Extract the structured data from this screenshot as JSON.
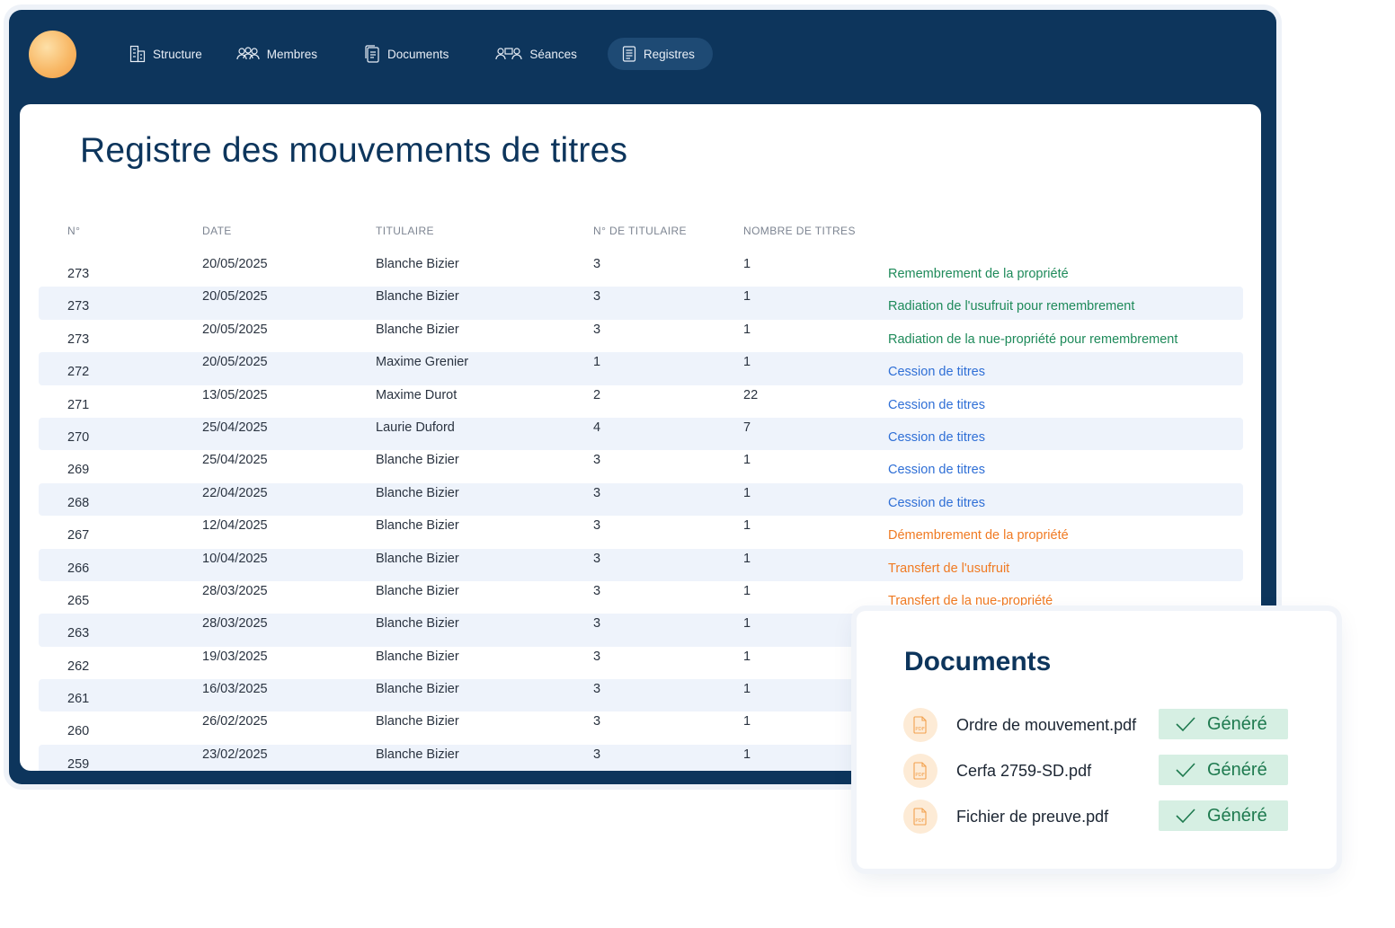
{
  "nav": {
    "items": [
      {
        "label": "Structure",
        "icon": "building-icon"
      },
      {
        "label": "Membres",
        "icon": "members-icon"
      },
      {
        "label": "Documents",
        "icon": "documents-icon"
      },
      {
        "label": "Séances",
        "icon": "meetings-icon"
      },
      {
        "label": "Registres",
        "icon": "register-icon",
        "active": true
      }
    ]
  },
  "page": {
    "title": "Registre des mouvements de titres"
  },
  "table": {
    "headers": [
      "N°",
      "DATE",
      "TITULAIRE",
      "N° DE TITULAIRE",
      "NOMBRE DE TITRES"
    ],
    "rows": [
      {
        "num": "273",
        "date": "20/05/2025",
        "holder": "Blanche Bizier",
        "holder_num": "3",
        "count": "1",
        "operation": "Remembrement de la propriété",
        "color": "#1e8a5a"
      },
      {
        "num": "273",
        "date": "20/05/2025",
        "holder": "Blanche Bizier",
        "holder_num": "3",
        "count": "1",
        "operation": "Radiation de l'usufruit pour remembrement",
        "color": "#1e8a5a"
      },
      {
        "num": "273",
        "date": "20/05/2025",
        "holder": "Blanche Bizier",
        "holder_num": "3",
        "count": "1",
        "operation": "Radiation de la nue-propriété pour remembrement",
        "color": "#1e8a5a"
      },
      {
        "num": "272",
        "date": "20/05/2025",
        "holder": "Maxime Grenier",
        "holder_num": "1",
        "count": "1",
        "operation": "Cession de titres",
        "color": "#2f6fd6"
      },
      {
        "num": "271",
        "date": "13/05/2025",
        "holder": "Maxime Durot",
        "holder_num": "2",
        "count": "22",
        "operation": "Cession de titres",
        "color": "#2f6fd6"
      },
      {
        "num": "270",
        "date": "25/04/2025",
        "holder": "Laurie Duford",
        "holder_num": "4",
        "count": "7",
        "operation": "Cession de titres",
        "color": "#2f6fd6"
      },
      {
        "num": "269",
        "date": "25/04/2025",
        "holder": "Blanche Bizier",
        "holder_num": "3",
        "count": "1",
        "operation": "Cession de titres",
        "color": "#2f6fd6"
      },
      {
        "num": "268",
        "date": "22/04/2025",
        "holder": "Blanche Bizier",
        "holder_num": "3",
        "count": "1",
        "operation": "Cession de titres",
        "color": "#2f6fd6"
      },
      {
        "num": "267",
        "date": "12/04/2025",
        "holder": "Blanche Bizier",
        "holder_num": "3",
        "count": "1",
        "operation": "Démembrement de la propriété",
        "color": "#f07a22"
      },
      {
        "num": "266",
        "date": "10/04/2025",
        "holder": "Blanche Bizier",
        "holder_num": "3",
        "count": "1",
        "operation": "Transfert de l'usufruit",
        "color": "#f07a22"
      },
      {
        "num": "265",
        "date": "28/03/2025",
        "holder": "Blanche Bizier",
        "holder_num": "3",
        "count": "1",
        "operation": "Transfert de la nue-propriété",
        "color": "#f07a22"
      },
      {
        "num": "263",
        "date": "28/03/2025",
        "holder": "Blanche Bizier",
        "holder_num": "3",
        "count": "1",
        "operation": "",
        "color": "#2f6fd6"
      },
      {
        "num": "262",
        "date": "19/03/2025",
        "holder": "Blanche Bizier",
        "holder_num": "3",
        "count": "1",
        "operation": "",
        "color": "#2f6fd6"
      },
      {
        "num": "261",
        "date": "16/03/2025",
        "holder": "Blanche Bizier",
        "holder_num": "3",
        "count": "1",
        "operation": "",
        "color": "#2f6fd6"
      },
      {
        "num": "260",
        "date": "26/02/2025",
        "holder": "Blanche Bizier",
        "holder_num": "3",
        "count": "1",
        "operation": "",
        "color": "#2f6fd6"
      },
      {
        "num": "259",
        "date": "23/02/2025",
        "holder": "Blanche Bizier",
        "holder_num": "3",
        "count": "1",
        "operation": "",
        "color": "#2f6fd6"
      }
    ]
  },
  "documents": {
    "title": "Documents",
    "items": [
      {
        "name": "Ordre de mouvement.pdf",
        "status": "Généré"
      },
      {
        "name": "Cerfa 2759-SD.pdf",
        "status": "Généré"
      },
      {
        "name": "Fichier de preuve.pdf",
        "status": "Généré"
      }
    ],
    "pdf_label": "PDF"
  }
}
